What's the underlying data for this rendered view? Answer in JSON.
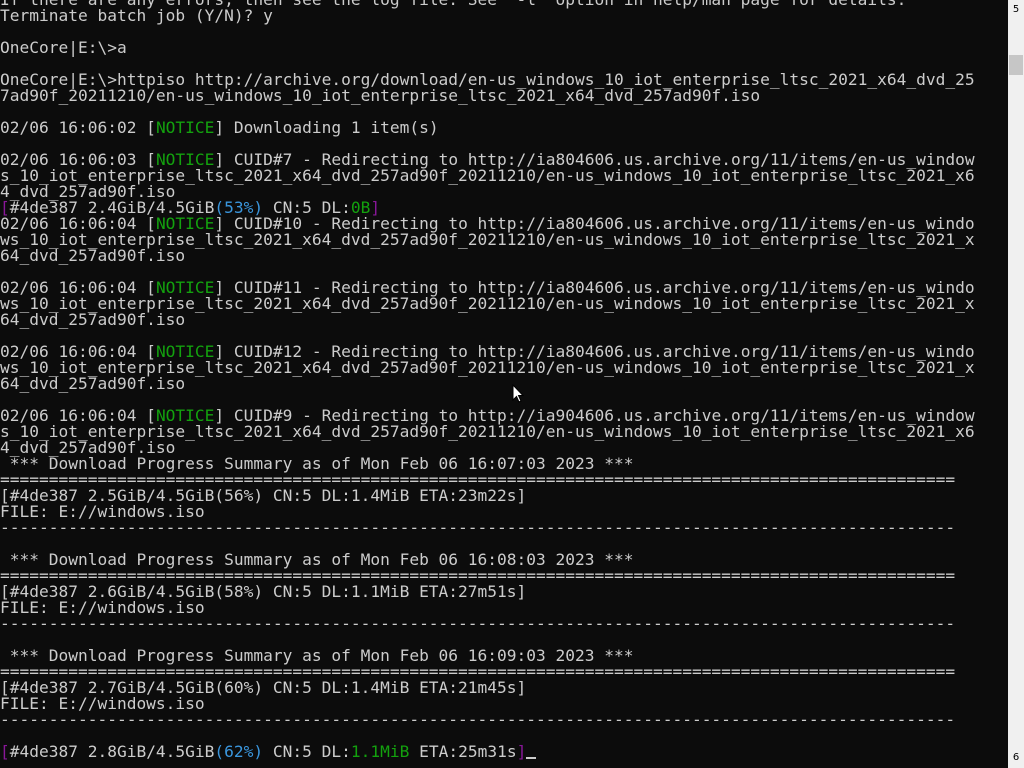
{
  "terminal": {
    "lines": [
      [
        [
          "If there are any errors, then see the log file. See '-l' option in help/man page for details.",
          ""
        ]
      ],
      [
        [
          "Terminate batch job (Y/N)? y",
          ""
        ]
      ],
      [
        [
          "",
          ""
        ]
      ],
      [
        [
          "OneCore|E:\\>a",
          ""
        ]
      ],
      [
        [
          "",
          ""
        ]
      ],
      [
        [
          "OneCore|E:\\>httpiso http://archive.org/download/en-us_windows_10_iot_enterprise_ltsc_2021_x64_dvd_25",
          ""
        ]
      ],
      [
        [
          "7ad90f_20211210/en-us_windows_10_iot_enterprise_ltsc_2021_x64_dvd_257ad90f.iso",
          ""
        ]
      ],
      [
        [
          "",
          ""
        ]
      ],
      [
        [
          "02/06 16:06:02 [",
          ""
        ],
        [
          "NOTICE",
          "c-notice"
        ],
        [
          "] Downloading 1 item(s)",
          ""
        ]
      ],
      [
        [
          "",
          ""
        ]
      ],
      [
        [
          "02/06 16:06:03 [",
          ""
        ],
        [
          "NOTICE",
          "c-notice"
        ],
        [
          "] CUID#7 - Redirecting to http://ia804606.us.archive.org/11/items/en-us_window",
          ""
        ]
      ],
      [
        [
          "s_10_iot_enterprise_ltsc_2021_x64_dvd_257ad90f_20211210/en-us_windows_10_iot_enterprise_ltsc_2021_x6",
          ""
        ]
      ],
      [
        [
          "4_dvd_257ad90f.iso",
          ""
        ]
      ],
      [
        [
          "[",
          "c-mag"
        ],
        [
          "#4de387 2.4GiB/4.5GiB",
          ""
        ],
        [
          "(53%)",
          "c-cyan"
        ],
        [
          " CN:5 DL:",
          ""
        ],
        [
          "0B",
          "c-green"
        ],
        [
          "]",
          "c-mag"
        ]
      ],
      [
        [
          "02/06 16:06:04 [",
          ""
        ],
        [
          "NOTICE",
          "c-notice"
        ],
        [
          "] CUID#10 - Redirecting to http://ia804606.us.archive.org/11/items/en-us_windo",
          ""
        ]
      ],
      [
        [
          "ws_10_iot_enterprise_ltsc_2021_x64_dvd_257ad90f_20211210/en-us_windows_10_iot_enterprise_ltsc_2021_x",
          ""
        ]
      ],
      [
        [
          "64_dvd_257ad90f.iso",
          ""
        ]
      ],
      [
        [
          "",
          ""
        ]
      ],
      [
        [
          "02/06 16:06:04 [",
          ""
        ],
        [
          "NOTICE",
          "c-notice"
        ],
        [
          "] CUID#11 - Redirecting to http://ia804606.us.archive.org/11/items/en-us_windo",
          ""
        ]
      ],
      [
        [
          "ws_10_iot_enterprise_ltsc_2021_x64_dvd_257ad90f_20211210/en-us_windows_10_iot_enterprise_ltsc_2021_x",
          ""
        ]
      ],
      [
        [
          "64_dvd_257ad90f.iso",
          ""
        ]
      ],
      [
        [
          "",
          ""
        ]
      ],
      [
        [
          "02/06 16:06:04 [",
          ""
        ],
        [
          "NOTICE",
          "c-notice"
        ],
        [
          "] CUID#12 - Redirecting to http://ia804606.us.archive.org/11/items/en-us_windo",
          ""
        ]
      ],
      [
        [
          "ws_10_iot_enterprise_ltsc_2021_x64_dvd_257ad90f_20211210/en-us_windows_10_iot_enterprise_ltsc_2021_x",
          ""
        ]
      ],
      [
        [
          "64_dvd_257ad90f.iso",
          ""
        ]
      ],
      [
        [
          "",
          ""
        ]
      ],
      [
        [
          "02/06 16:06:04 [",
          ""
        ],
        [
          "NOTICE",
          "c-notice"
        ],
        [
          "] CUID#9 - Redirecting to http://ia904606.us.archive.org/11/items/en-us_window",
          ""
        ]
      ],
      [
        [
          "s_10_iot_enterprise_ltsc_2021_x64_dvd_257ad90f_20211210/en-us_windows_10_iot_enterprise_ltsc_2021_x6",
          ""
        ]
      ],
      [
        [
          "4_dvd_257ad90f.iso",
          ""
        ]
      ],
      [
        [
          " *** Download Progress Summary as of Mon Feb 06 16:07:03 2023 ***",
          ""
        ]
      ],
      [
        [
          "==================================================================================================",
          ""
        ]
      ],
      [
        [
          "[#4de387 2.5GiB/4.5GiB(56%) CN:5 DL:1.4MiB ETA:23m22s]",
          ""
        ]
      ],
      [
        [
          "FILE: E://windows.iso",
          ""
        ]
      ],
      [
        [
          "--------------------------------------------------------------------------------------------------",
          ""
        ]
      ],
      [
        [
          "",
          ""
        ]
      ],
      [
        [
          " *** Download Progress Summary as of Mon Feb 06 16:08:03 2023 ***",
          ""
        ]
      ],
      [
        [
          "==================================================================================================",
          ""
        ]
      ],
      [
        [
          "[#4de387 2.6GiB/4.5GiB(58%) CN:5 DL:1.1MiB ETA:27m51s]",
          ""
        ]
      ],
      [
        [
          "FILE: E://windows.iso",
          ""
        ]
      ],
      [
        [
          "--------------------------------------------------------------------------------------------------",
          ""
        ]
      ],
      [
        [
          "",
          ""
        ]
      ],
      [
        [
          " *** Download Progress Summary as of Mon Feb 06 16:09:03 2023 ***",
          ""
        ]
      ],
      [
        [
          "==================================================================================================",
          ""
        ]
      ],
      [
        [
          "[#4de387 2.7GiB/4.5GiB(60%) CN:5 DL:1.4MiB ETA:21m45s]",
          ""
        ]
      ],
      [
        [
          "FILE: E://windows.iso",
          ""
        ]
      ],
      [
        [
          "--------------------------------------------------------------------------------------------------",
          ""
        ]
      ],
      [
        [
          "",
          ""
        ]
      ],
      [
        [
          "[",
          "c-mag"
        ],
        [
          "#4de387 2.8GiB/4.5GiB",
          ""
        ],
        [
          "(62%)",
          "c-cyan"
        ],
        [
          " CN:5 DL:",
          ""
        ],
        [
          "1.1MiB",
          "c-green"
        ],
        [
          " ETA:25m31s",
          ""
        ],
        [
          "]",
          "c-mag"
        ]
      ]
    ]
  },
  "scrollbar": {
    "top_label": "5",
    "bottom_label": "6"
  },
  "colors": {
    "background": "#0c0c0c",
    "text": "#cccccc",
    "notice": "#13a10e",
    "bracket": "#881798",
    "percent": "#3a96dd",
    "speed": "#13a10e"
  },
  "icons": {
    "pointer": "mouse-pointer-icon"
  }
}
